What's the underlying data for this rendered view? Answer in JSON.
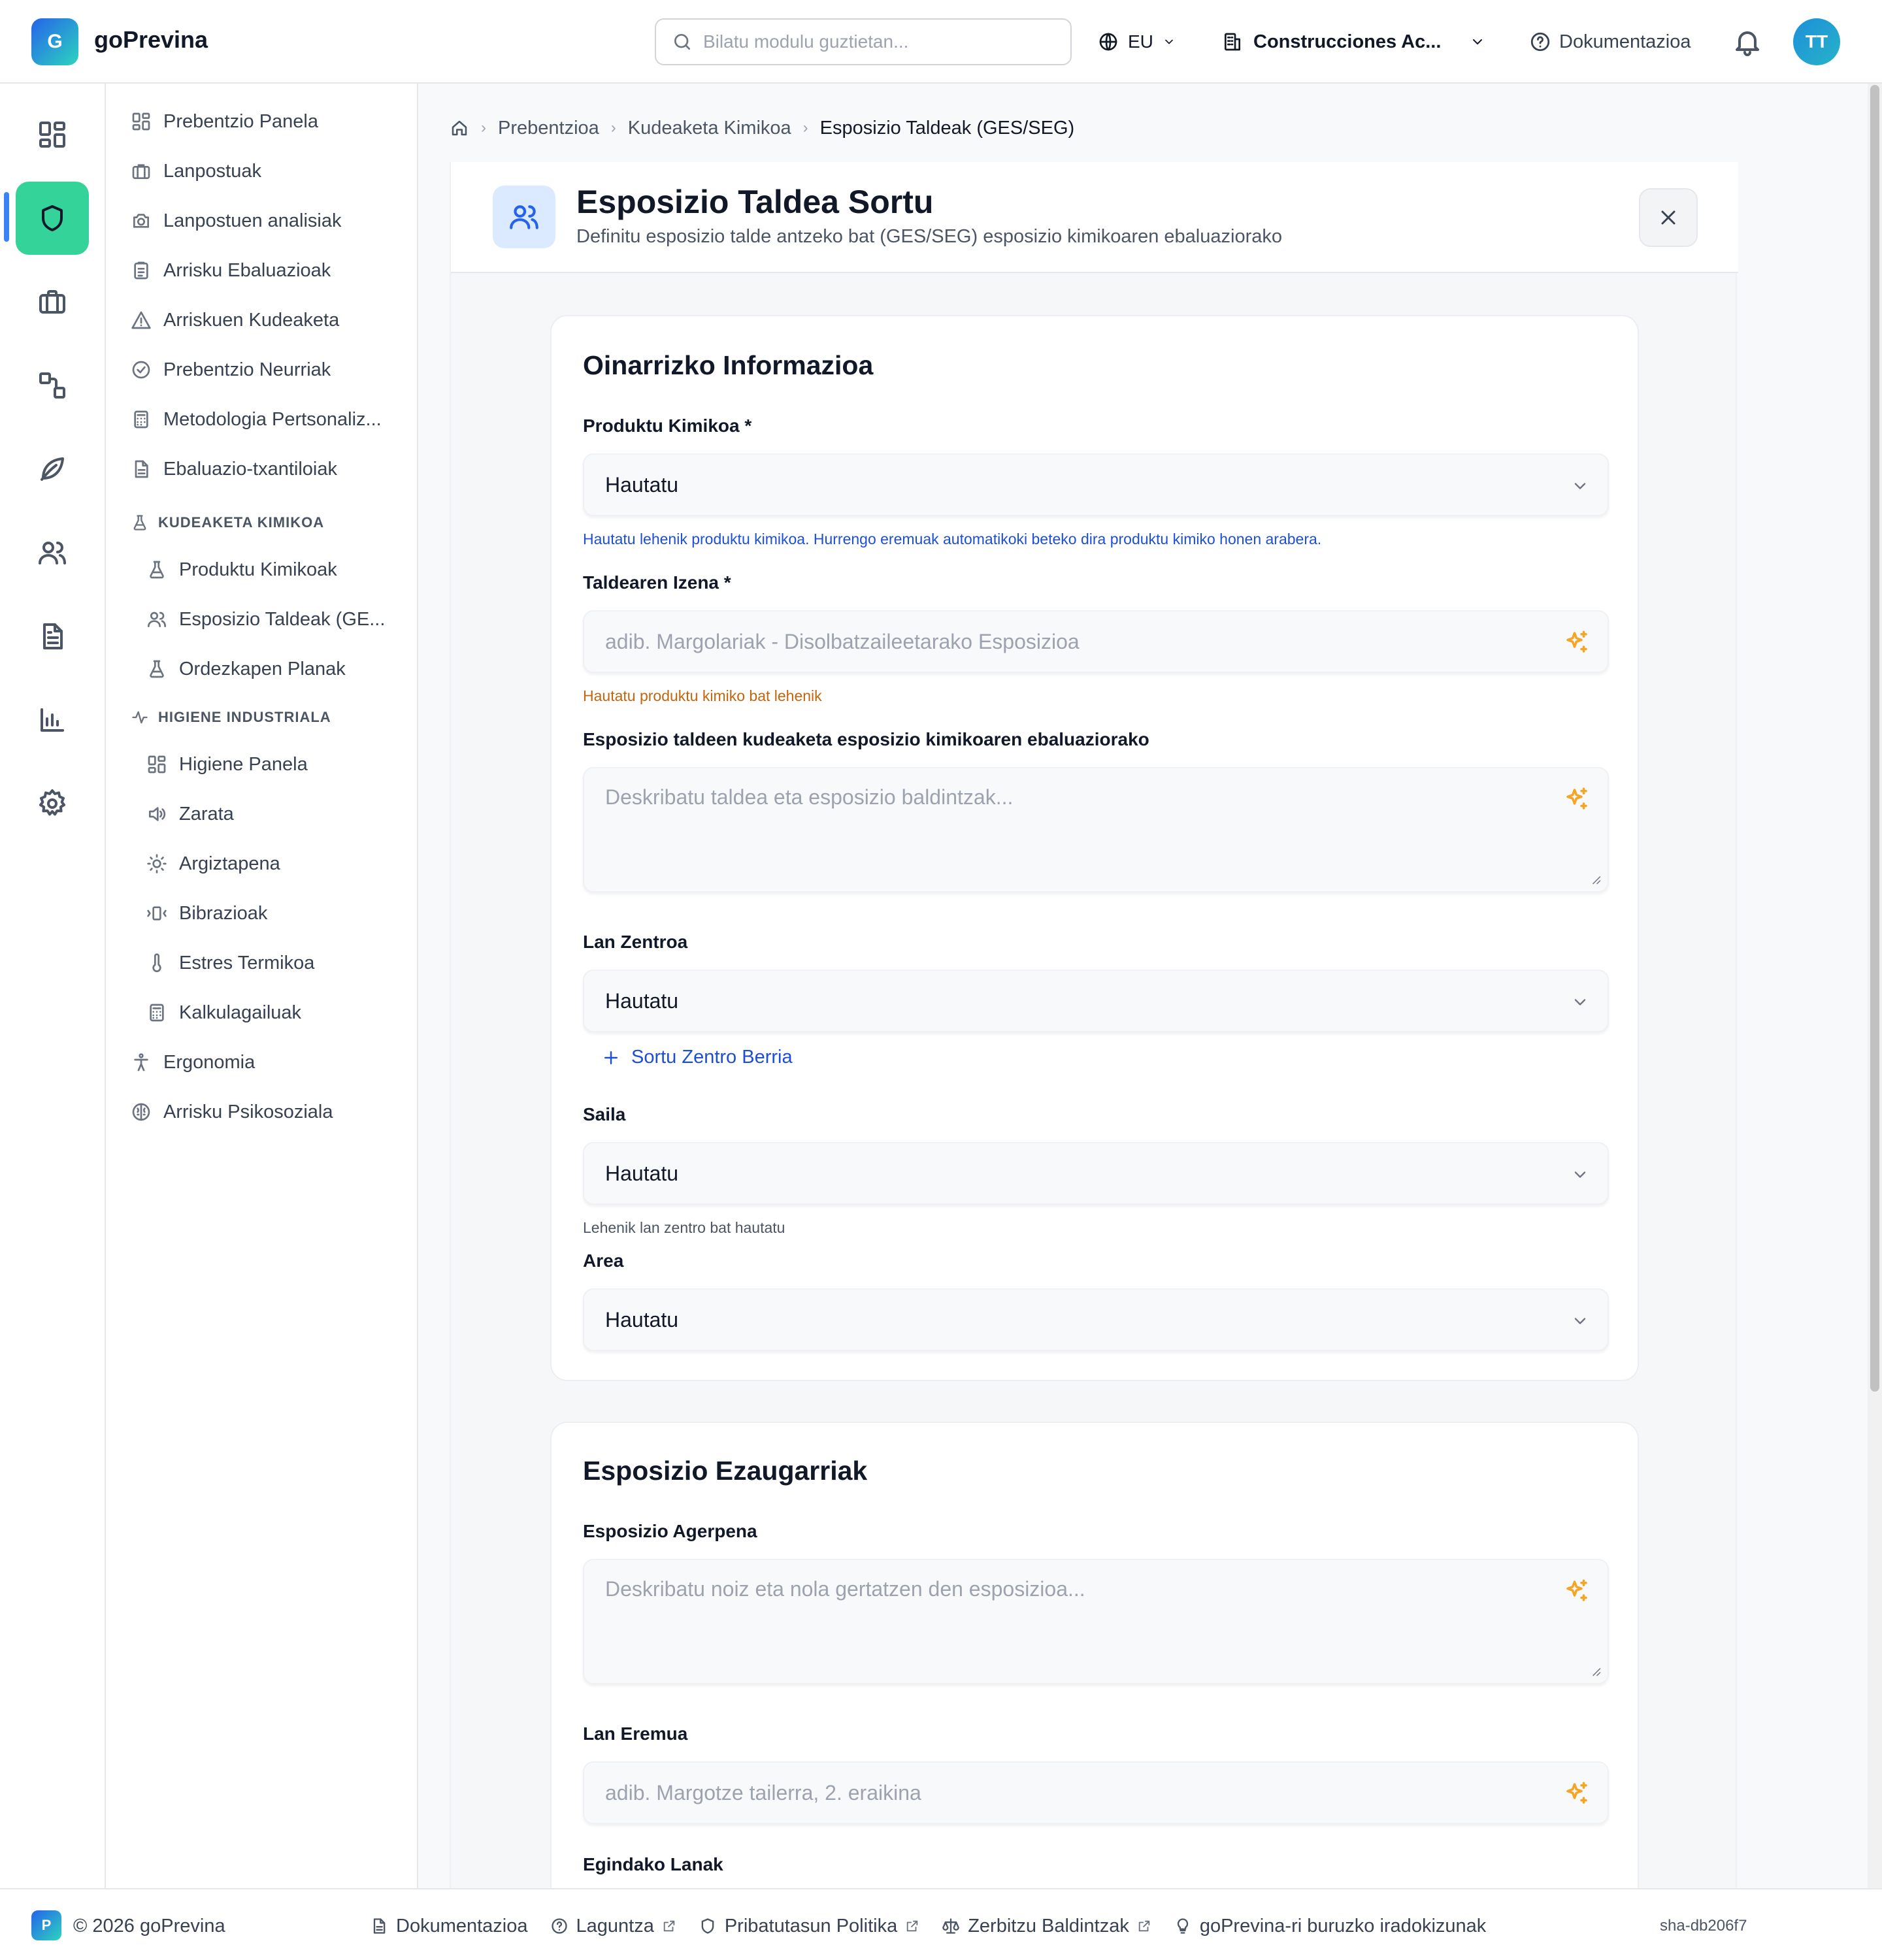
{
  "app": {
    "logo_letter": "G",
    "name": "goPrevina"
  },
  "header": {
    "search_placeholder": "Bilatu modulu guztietan...",
    "language": "EU",
    "company": "Construcciones Ac...",
    "docs_label": "Dokumentazioa",
    "avatar_initials": "TT"
  },
  "rail": {
    "items": [
      "dashboard-icon",
      "shield-icon",
      "briefcase-icon",
      "workflow-icon",
      "leaf-icon",
      "users-icon",
      "file-icon",
      "bar-chart-icon",
      "settings-icon"
    ],
    "active": "shield-icon",
    "accent": "#34d399"
  },
  "subnav": {
    "items": [
      {
        "label": "Prebentzio Panela",
        "icon": "grid-icon"
      },
      {
        "label": "Lanpostuak",
        "icon": "briefcase-icon"
      },
      {
        "label": "Lanpostuen analisiak",
        "icon": "camera-icon"
      },
      {
        "label": "Arrisku Ebaluazioak",
        "icon": "clipboard-icon"
      },
      {
        "label": "Arriskuen Kudeaketa",
        "icon": "warning-icon"
      },
      {
        "label": "Prebentzio Neurriak",
        "icon": "check-circle-icon"
      },
      {
        "label": "Metodologia Pertsonaliz...",
        "icon": "calculator-icon"
      },
      {
        "label": "Ebaluazio-txantiloiak",
        "icon": "file-icon"
      }
    ],
    "chem_section": "KUDEAKETA KIMIKOA",
    "chem_items": [
      {
        "label": "Produktu Kimikoak",
        "icon": "flask-icon"
      },
      {
        "label": "Esposizio Taldeak (GE...",
        "icon": "users-icon"
      },
      {
        "label": "Ordezkapen Planak",
        "icon": "flask-icon"
      }
    ],
    "hyg_section": "HIGIENE INDUSTRIALA",
    "hyg_items": [
      {
        "label": "Higiene Panela",
        "icon": "grid-icon"
      },
      {
        "label": "Zarata",
        "icon": "volume-icon"
      },
      {
        "label": "Argiztapena",
        "icon": "sun-icon"
      },
      {
        "label": "Bibrazioak",
        "icon": "vibrate-icon"
      },
      {
        "label": "Estres Termikoa",
        "icon": "thermometer-icon"
      },
      {
        "label": "Kalkulagailuak",
        "icon": "calculator-icon"
      }
    ],
    "bottom_items": [
      {
        "label": "Ergonomia",
        "icon": "person-icon"
      },
      {
        "label": "Arrisku Psikosoziala",
        "icon": "brain-icon"
      }
    ]
  },
  "breadcrumb": [
    "Prebentzioa",
    "Kudeaketa Kimikoa",
    "Esposizio Taldeak (GES/SEG)"
  ],
  "page": {
    "title": "Esposizio Taldea Sortu",
    "subtitle": "Definitu esposizio talde antzeko bat (GES/SEG) esposizio kimikoaren ebaluaziorako"
  },
  "basic": {
    "title": "Oinarrizko Informazioa",
    "product_label": "Produktu Kimikoa *",
    "product_value": "Hautatu",
    "product_hint": "Hautatu lehenik produktu kimikoa. Hurrengo eremuak automatikoki beteko dira produktu kimiko honen arabera.",
    "group_name_label": "Taldearen Izena *",
    "group_name_placeholder": "adib. Margolariak - Disolbatzaileetarako Esposizioa",
    "group_name_hint": "Hautatu produktu kimiko bat lehenik",
    "description_label": "Esposizio taldeen kudeaketa esposizio kimikoaren ebaluaziorako",
    "description_placeholder": "Deskribatu taldea eta esposizio baldintzak...",
    "workcenter_label": "Lan Zentroa",
    "workcenter_value": "Hautatu",
    "add_center_label": "Sortu Zentro Berria",
    "department_label": "Saila",
    "department_value": "Hautatu",
    "department_hint": "Lehenik lan zentro bat hautatu",
    "area_label": "Area",
    "area_value": "Hautatu"
  },
  "exposure": {
    "title": "Esposizio Ezaugarriak",
    "appearance_label": "Esposizio Agerpena",
    "appearance_placeholder": "Deskribatu noiz eta nola gertatzen den esposizioa...",
    "work_area_label": "Lan Eremua",
    "work_area_placeholder": "adib. Margotze tailerra, 2. eraikina",
    "tasks_label": "Egindako Lanak"
  },
  "footer": {
    "logo_letter": "P",
    "copyright": "© 2026 goPrevina",
    "links": [
      {
        "label": "Dokumentazioa",
        "icon": "file-icon",
        "external": false
      },
      {
        "label": "Laguntza",
        "icon": "help-icon",
        "external": true
      },
      {
        "label": "Pribatutasun Politika",
        "icon": "shield-icon",
        "external": true
      },
      {
        "label": "Zerbitzu Baldintzak",
        "icon": "scale-icon",
        "external": true
      },
      {
        "label": "goPrevina-ri buruzko iradokizunak",
        "icon": "lightbulb-icon",
        "external": false
      }
    ],
    "version": "sha-db206f7"
  }
}
